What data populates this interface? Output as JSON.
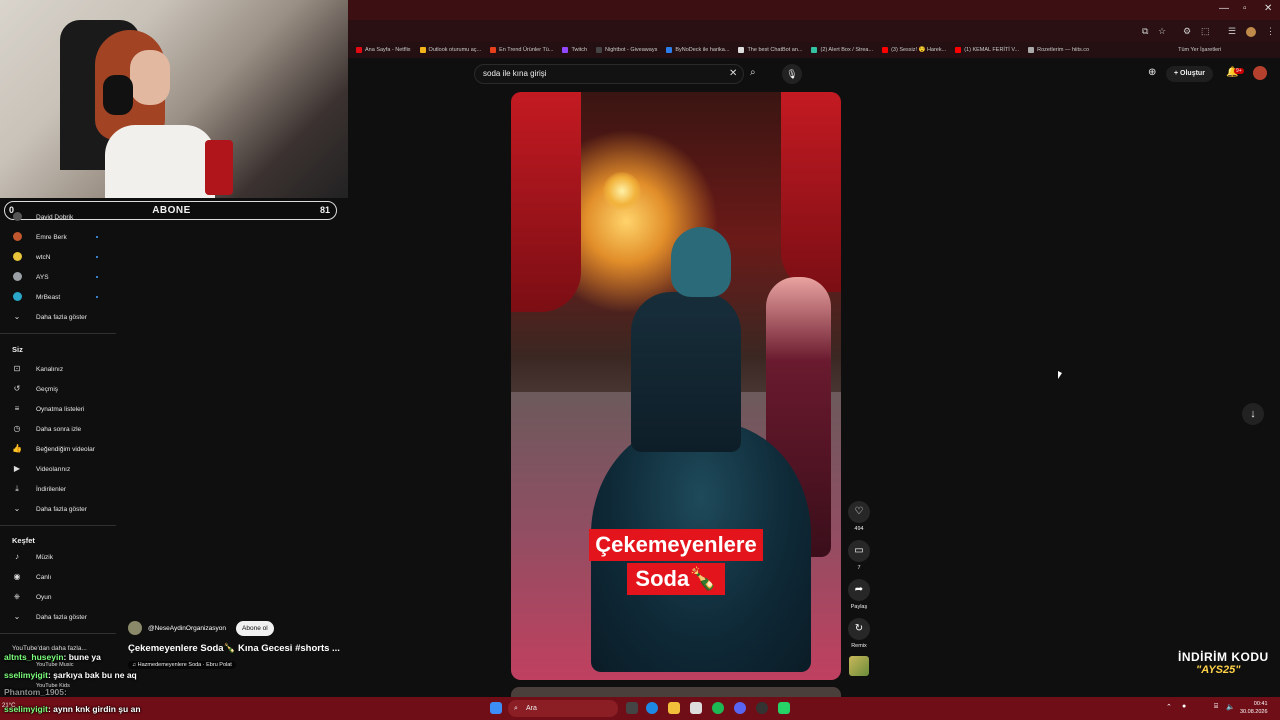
{
  "browser": {
    "bookmarks": [
      {
        "label": "Ana Sayfa - Netflix",
        "color": "#e50914"
      },
      {
        "label": "Outlook oturumu aç...",
        "color": "#f3b31a"
      },
      {
        "label": "En Trend Ürünler Tü...",
        "color": "#e8401c"
      },
      {
        "label": "Twitch",
        "color": "#9146ff"
      },
      {
        "label": "Nightbot - Giveaways",
        "color": "#444444"
      },
      {
        "label": "ByNoDeck ile harika...",
        "color": "#2b7de9"
      },
      {
        "label": "The best ChatBot an...",
        "color": "#dddddd"
      },
      {
        "label": "(2) Alert Box / Strea...",
        "color": "#31c3a2"
      },
      {
        "label": "(3) Sessiz! 😯 Harek...",
        "color": "#ff0000"
      },
      {
        "label": "(1) KEMAL FERİTİ V...",
        "color": "#ff0000"
      },
      {
        "label": "Rozetlerim — hiits.co",
        "color": "#aaaaaa"
      }
    ],
    "all_bookmarks": "Tüm Yer İşaretleri"
  },
  "header": {
    "search_query": "soda ile kına girişi",
    "create_label": "Oluştur",
    "notif_badge": "9+"
  },
  "overlay": {
    "subscribe_goal": "ABONE",
    "goal_left": "0",
    "goal_count": "81",
    "promo_line1": "İNDİRİM KODU",
    "promo_line2": "\"AYS25\""
  },
  "sidebar": {
    "subscriptions": [
      {
        "label": "David Dobrik",
        "color": "#555555"
      },
      {
        "label": "Emre Berk",
        "color": "#c0572e"
      },
      {
        "label": "wtcN",
        "color": "#e8c43a"
      },
      {
        "label": "AYS",
        "color": "#9aa0a6"
      },
      {
        "label": "MrBeast",
        "color": "#2aa6c9"
      }
    ],
    "show_more_1": "Daha fazla göster",
    "you_section": "Siz",
    "you_items": [
      {
        "label": "Kanalınız",
        "icon": "user-square-icon"
      },
      {
        "label": "Geçmiş",
        "icon": "history-icon"
      },
      {
        "label": "Oynatma listeleri",
        "icon": "playlist-icon"
      },
      {
        "label": "Daha sonra izle",
        "icon": "clock-icon"
      },
      {
        "label": "Beğendiğim videolar",
        "icon": "thumbs-up-icon"
      },
      {
        "label": "Videolarınız",
        "icon": "video-icon"
      },
      {
        "label": "İndirilenler",
        "icon": "download-icon"
      }
    ],
    "show_more_2": "Daha fazla göster",
    "explore_section": "Keşfet",
    "explore_items": [
      {
        "label": "Müzik",
        "icon": "music-note-icon"
      },
      {
        "label": "Canlı",
        "icon": "live-icon"
      },
      {
        "label": "Oyun",
        "icon": "gamepad-icon"
      }
    ],
    "show_more_3": "Daha fazla göster",
    "more_from_youtube": "YouTube'dan daha fazla...",
    "yt_music": "YouTube Music",
    "yt_kids": "YouTube Kids"
  },
  "short": {
    "caption_line1": "Çekemeyenlere",
    "caption_line2": "Soda🍾",
    "like_count": "494",
    "comment_count": "7",
    "share_label": "Paylaş",
    "remix_label": "Remix",
    "channel": "@NeseAydinOrganizasyon",
    "subscribe_label": "Abone ol",
    "title": "Çekemeyenlere Soda🍾 Kına Gecesi #shorts ...",
    "music": "♫ Hazmedemeyenlere Soda · Ebru Polat"
  },
  "chat": [
    {
      "user": "altnts_huseyin",
      "msg": ": bune ya"
    },
    {
      "user": "sselimyigit",
      "msg": ": şarkıya bak bu ne aq"
    },
    {
      "user": "Phantom_1905",
      "msg": ":"
    },
    {
      "user": "sselimyigit",
      "msg": ": aynn knk girdin şu an"
    }
  ],
  "taskbar": {
    "search_label": "Ara",
    "time": "00:41",
    "date": "30.08.2026",
    "weather": "21°C"
  }
}
